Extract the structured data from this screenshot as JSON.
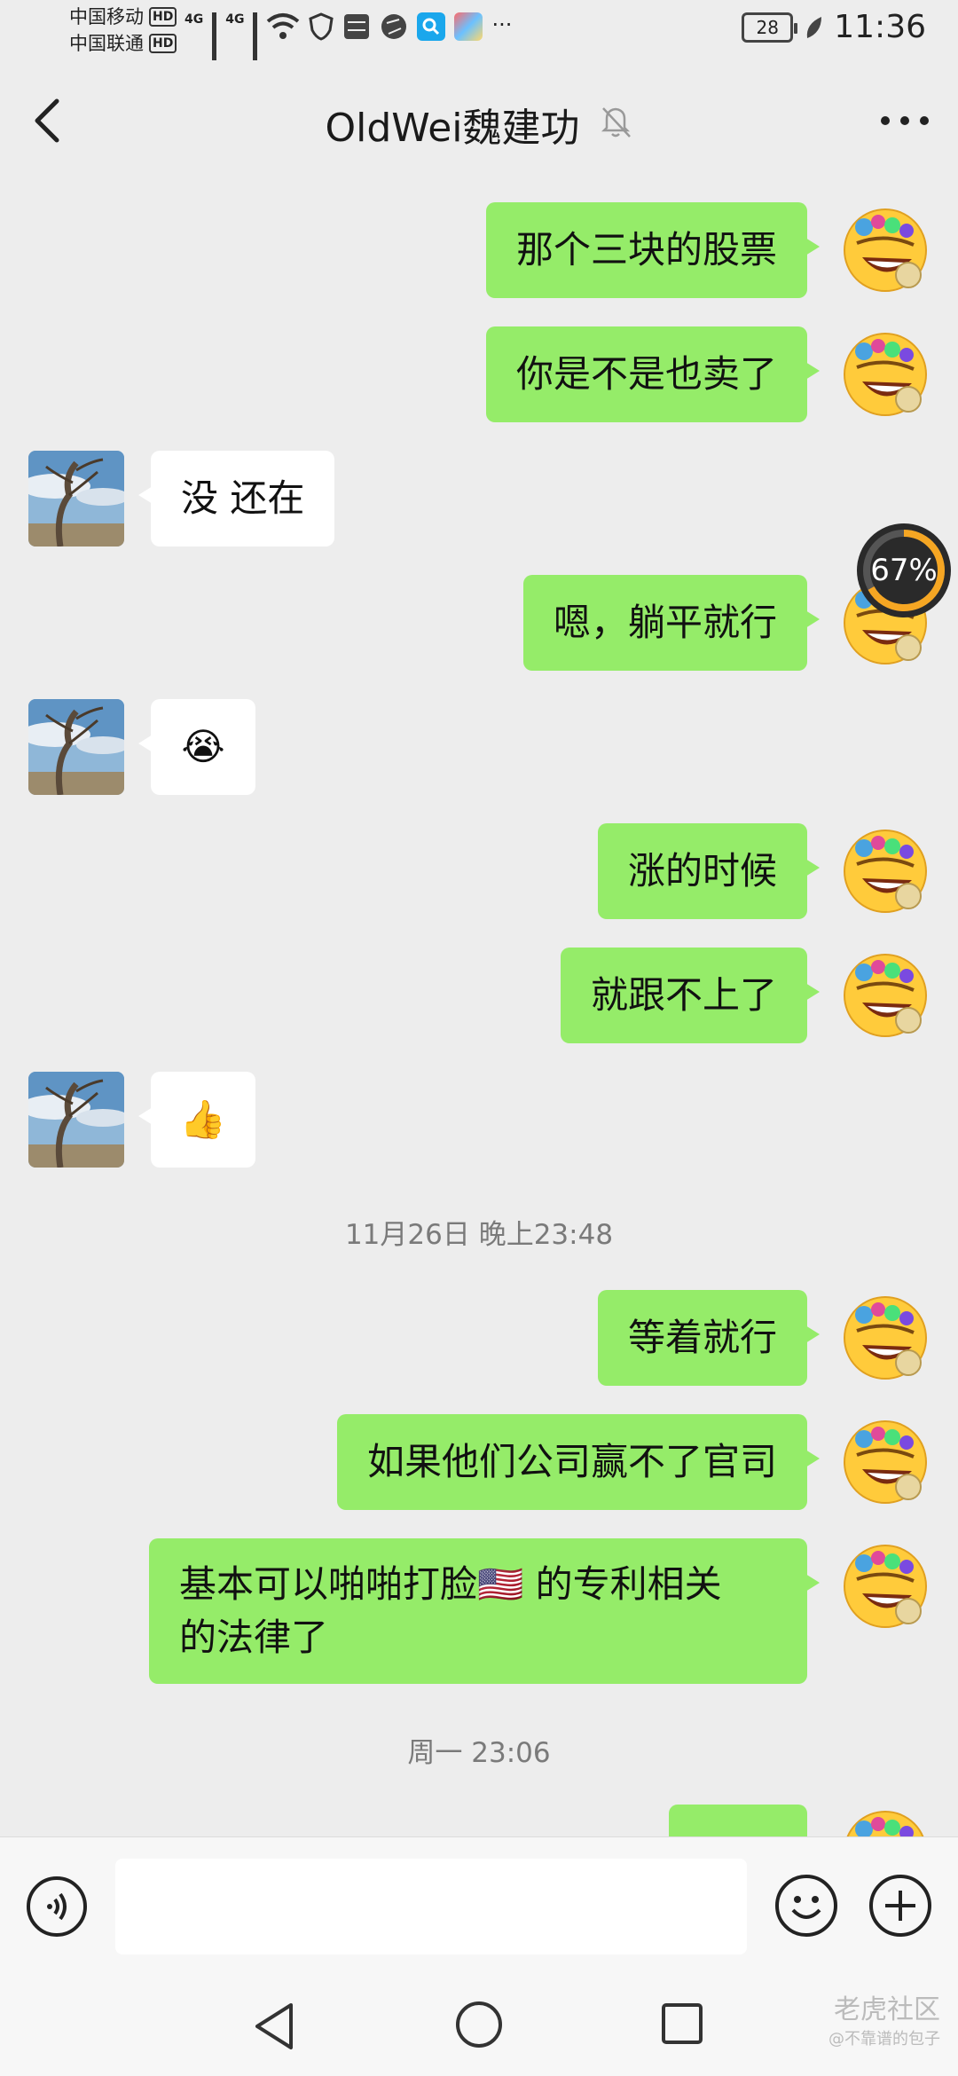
{
  "status_bar": {
    "carrier_1": "中国移动",
    "carrier_2": "中国联通",
    "hd": "HD",
    "network_1": "4G",
    "network_2": "4G",
    "more_icons": "···",
    "battery": "28",
    "time": "11:36"
  },
  "header": {
    "title": "OldWei魏建功"
  },
  "messages": [
    {
      "side": "sent",
      "text": "那个三块的股票"
    },
    {
      "side": "sent",
      "text": "你是不是也卖了"
    },
    {
      "side": "recv",
      "text": "没 还在"
    },
    {
      "side": "sent",
      "text": "嗯，躺平就行"
    },
    {
      "side": "recv",
      "text": "😭"
    },
    {
      "side": "sent",
      "text": "涨的时候"
    },
    {
      "side": "sent",
      "text": "就跟不上了"
    },
    {
      "side": "recv",
      "text": "👍"
    },
    {
      "side": "sent",
      "text": "等着就行"
    },
    {
      "side": "sent",
      "text": "如果他们公司赢不了官司"
    },
    {
      "side": "sent",
      "text_line1": "基本可以啪啪打脸🇺🇸 的专利相关",
      "text_line2": "的法律了"
    }
  ],
  "timestamps": {
    "t1": "11月26日 晚上23:48",
    "t2": "周一 23:06"
  },
  "overlay": {
    "progress": "67%",
    "progress_value": 0.67
  },
  "input": {
    "placeholder": ""
  },
  "watermark": {
    "main": "老虎社区",
    "sub": "@不靠谱的包子"
  },
  "colors": {
    "sent_bubble": "#95ec69",
    "recv_bubble": "#ffffff",
    "background": "#ededed"
  }
}
